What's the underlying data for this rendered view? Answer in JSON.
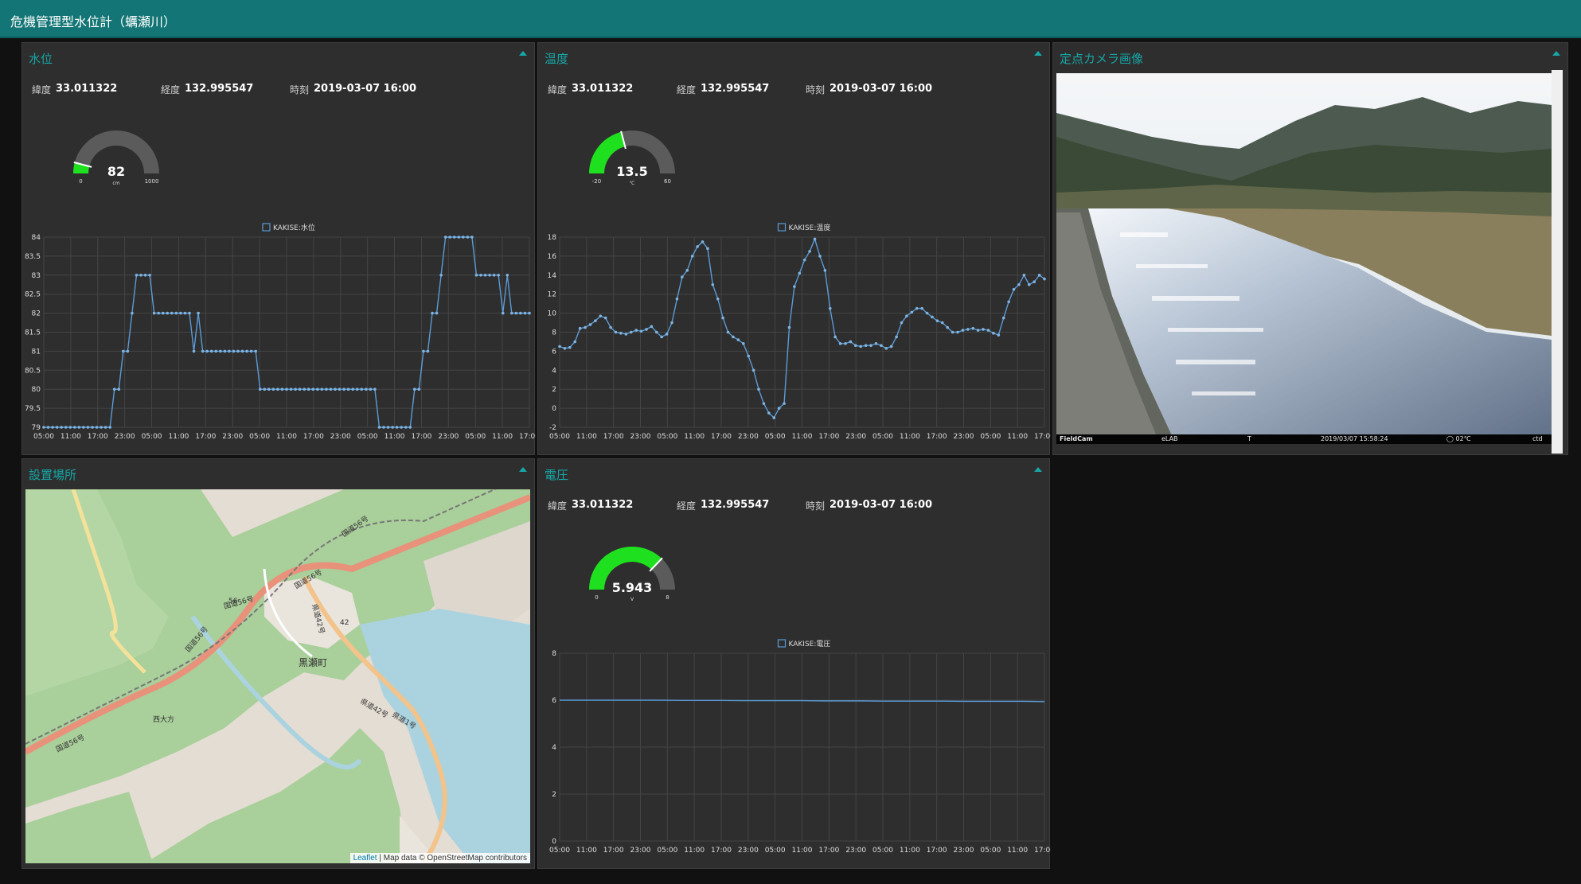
{
  "header": {
    "title": "危機管理型水位計（蠣瀬川）"
  },
  "panels": {
    "water": {
      "title": "水位",
      "lat_label": "緯度",
      "lat": "33.011322",
      "lon_label": "経度",
      "lon": "132.995547",
      "time_label": "時刻",
      "time": "2019-03-07 16:00",
      "gauge": {
        "value": 82,
        "display": "82",
        "min": 0,
        "max": 1000,
        "min_label": "0",
        "max_label": "1000",
        "unit": "cm"
      }
    },
    "temp": {
      "title": "温度",
      "lat_label": "緯度",
      "lat": "33.011322",
      "lon_label": "経度",
      "lon": "132.995547",
      "time_label": "時刻",
      "time": "2019-03-07 16:00",
      "gauge": {
        "value": 13.5,
        "display": "13.5",
        "min": -20,
        "max": 60,
        "min_label": "-20",
        "max_label": "60",
        "unit": "℃"
      }
    },
    "voltage": {
      "title": "電圧",
      "lat_label": "緯度",
      "lat": "33.011322",
      "lon_label": "経度",
      "lon": "132.995547",
      "time_label": "時刻",
      "time": "2019-03-07 16:00",
      "gauge": {
        "value": 5.943,
        "display": "5.943",
        "min": 0,
        "max": 8,
        "min_label": "0",
        "max_label": "8",
        "unit": "V"
      }
    },
    "map": {
      "title": "設置場所",
      "attribution_link": "Leaflet",
      "attribution_text": " | Map data © OpenStreetMap contributors",
      "labels": [
        "国道56号",
        "国道56号",
        "国道56号",
        "国道56号",
        "国道56号",
        "56",
        "42",
        "黒瀬町",
        "西大方",
        "県道42号",
        "県道42号",
        "県道1号"
      ]
    },
    "camera": {
      "title": "定点カメラ画像",
      "overlay": [
        "FieldCam",
        "eLAB",
        "T",
        "2019/03/07 15:58:24",
        "◯ 02℃",
        "ctd"
      ]
    }
  },
  "chart_data": [
    {
      "type": "line",
      "legend": "KAKISE:水位",
      "ylim": [
        79,
        84
      ],
      "yticks": [
        "79",
        "79.5",
        "80",
        "80.5",
        "81",
        "81.5",
        "82",
        "82.5",
        "83",
        "83.5",
        "84"
      ],
      "xticks": [
        "05:00",
        "11:00",
        "17:00",
        "23:00",
        "05:00",
        "11:00",
        "17:00",
        "23:00",
        "05:00",
        "11:00",
        "17:00",
        "23:00",
        "05:00",
        "11:00",
        "17:00",
        "23:00",
        "05:00",
        "11:00",
        "17:00"
      ],
      "x_start_hour": 5,
      "x_end_hour": 113,
      "x_step": 1,
      "series": [
        {
          "name": "KAKISE:水位",
          "color": "#5b9bd5",
          "values": [
            79,
            79,
            79,
            79,
            79,
            79,
            79,
            79,
            79,
            79,
            79,
            79,
            79,
            79,
            79,
            79,
            80,
            80,
            81,
            81,
            82,
            83,
            83,
            83,
            83,
            82,
            82,
            82,
            82,
            82,
            82,
            82,
            82,
            82,
            81,
            82,
            81,
            81,
            81,
            81,
            81,
            81,
            81,
            81,
            81,
            81,
            81,
            81,
            81,
            80,
            80,
            80,
            80,
            80,
            80,
            80,
            80,
            80,
            80,
            80,
            80,
            80,
            80,
            80,
            80,
            80,
            80,
            80,
            80,
            80,
            80,
            80,
            80,
            80,
            80,
            80,
            79,
            79,
            79,
            79,
            79,
            79,
            79,
            79,
            80,
            80,
            81,
            81,
            82,
            82,
            83,
            84,
            84,
            84,
            84,
            84,
            84,
            84,
            83,
            83,
            83,
            83,
            83,
            83,
            82,
            83,
            82,
            82,
            82,
            82,
            82
          ]
        }
      ]
    },
    {
      "type": "line",
      "legend": "KAKISE:温度",
      "ylim": [
        -2,
        18
      ],
      "yticks": [
        "-2",
        "0",
        "2",
        "4",
        "6",
        "8",
        "10",
        "12",
        "14",
        "16",
        "18"
      ],
      "xticks": [
        "05:00",
        "11:00",
        "17:00",
        "23:00",
        "05:00",
        "11:00",
        "17:00",
        "23:00",
        "05:00",
        "11:00",
        "17:00",
        "23:00",
        "05:00",
        "11:00",
        "17:00",
        "23:00",
        "05:00",
        "11:00",
        "17:00"
      ],
      "x_start_hour": 5,
      "x_end_hour": 113,
      "x_step": 1,
      "series": [
        {
          "name": "KAKISE:温度",
          "color": "#5b9bd5",
          "values": [
            6.5,
            6.3,
            6.4,
            7.0,
            8.4,
            8.5,
            8.8,
            9.2,
            9.7,
            9.5,
            8.5,
            8.0,
            7.9,
            7.8,
            8.0,
            8.2,
            8.1,
            8.3,
            8.6,
            8.0,
            7.5,
            7.8,
            9.0,
            11.5,
            13.8,
            14.5,
            16.0,
            17.0,
            17.5,
            16.8,
            13.0,
            11.5,
            9.5,
            8.0,
            7.5,
            7.2,
            6.8,
            5.5,
            4.0,
            2.0,
            0.5,
            -0.5,
            -1.0,
            0,
            0.5,
            8.5,
            12.8,
            14.2,
            15.6,
            16.5,
            17.8,
            16.0,
            14.5,
            10.5,
            7.5,
            6.8,
            6.8,
            7.0,
            6.6,
            6.5,
            6.6,
            6.6,
            6.8,
            6.6,
            6.3,
            6.5,
            7.5,
            9.0,
            9.7,
            10.1,
            10.5,
            10.5,
            10.0,
            9.6,
            9.2,
            9.0,
            8.5,
            8.0,
            8.0,
            8.2,
            8.3,
            8.4,
            8.2,
            8.3,
            8.2,
            7.9,
            7.7,
            9.5,
            11.2,
            12.5,
            13.0,
            14.0,
            13.0,
            13.3,
            14.0,
            13.6
          ]
        }
      ]
    },
    {
      "type": "line",
      "legend": "KAKISE:電圧",
      "ylim": [
        0,
        8
      ],
      "yticks": [
        "0",
        "2",
        "4",
        "6",
        "8"
      ],
      "xticks": [
        "05:00",
        "11:00",
        "17:00",
        "23:00",
        "05:00",
        "11:00",
        "17:00",
        "23:00",
        "05:00",
        "11:00",
        "17:00",
        "23:00",
        "05:00",
        "11:00",
        "17:00",
        "23:00",
        "05:00",
        "11:00",
        "17:00"
      ],
      "x_start_hour": 5,
      "x_end_hour": 113,
      "x_step": 1,
      "series": [
        {
          "name": "KAKISE:電圧",
          "color": "#5b9bd5",
          "values": [
            6.0,
            6.0,
            6.0,
            6.0,
            6.0,
            6.0,
            5.99,
            5.99,
            5.99,
            5.98,
            5.98,
            5.98,
            5.98,
            5.97,
            5.97,
            5.97,
            5.96,
            5.96,
            5.96,
            5.96,
            5.95,
            5.95,
            5.95,
            5.95,
            5.94
          ]
        }
      ]
    }
  ]
}
